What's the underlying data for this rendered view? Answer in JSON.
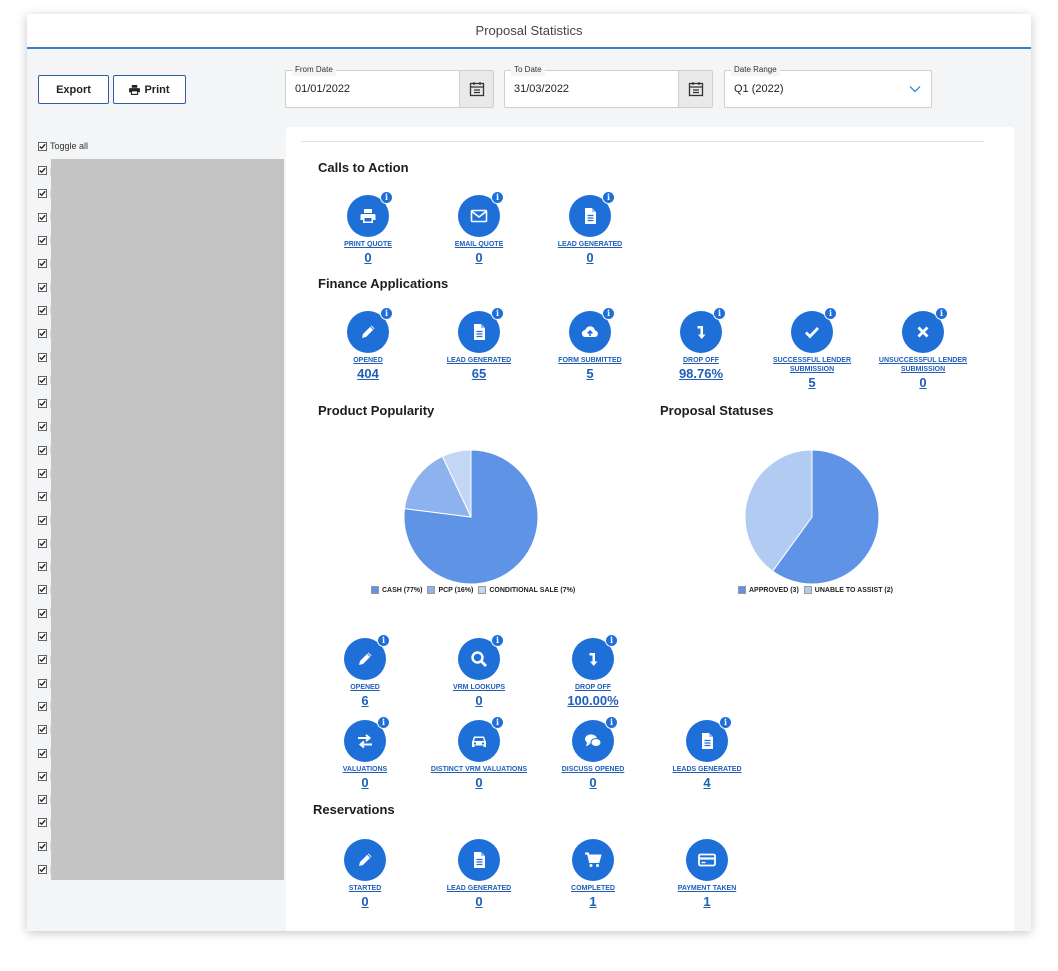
{
  "window": {
    "title": "Proposal Statistics"
  },
  "toolbar": {
    "export_label": "Export",
    "print_label": "Print"
  },
  "filters": {
    "from_date": {
      "label": "From Date",
      "value": "01/01/2022"
    },
    "to_date": {
      "label": "To Date",
      "value": "31/03/2022"
    },
    "date_range": {
      "label": "Date Range",
      "value": "Q1 (2022)"
    }
  },
  "sidebar": {
    "toggle_all": "Toggle all",
    "item_count": 31
  },
  "sections": {
    "calls_to_action": {
      "title": "Calls to Action",
      "stats": [
        {
          "label": "PRINT QUOTE",
          "value": "0",
          "icon": "print-icon"
        },
        {
          "label": "EMAIL QUOTE",
          "value": "0",
          "icon": "envelope-icon"
        },
        {
          "label": "LEAD GENERATED",
          "value": "0",
          "icon": "document-icon"
        }
      ]
    },
    "finance_applications": {
      "title": "Finance Applications",
      "stats": [
        {
          "label": "OPENED",
          "value": "404",
          "icon": "pencil-icon"
        },
        {
          "label": "LEAD GENERATED",
          "value": "65",
          "icon": "document-icon"
        },
        {
          "label": "FORM SUBMITTED",
          "value": "5",
          "icon": "cloud-upload-icon"
        },
        {
          "label": "DROP OFF",
          "value": "98.76%",
          "icon": "drop-arrow-icon"
        },
        {
          "label": "SUCCESSFUL LENDER SUBMISSION",
          "value": "5",
          "icon": "check-icon"
        },
        {
          "label": "UNSUCCESSFUL LENDER SUBMISSION",
          "value": "0",
          "icon": "cross-icon"
        }
      ]
    },
    "product_popularity": {
      "title": "Product Popularity"
    },
    "proposal_statuses": {
      "title": "Proposal Statuses"
    },
    "vehicle": {
      "stats": [
        {
          "label": "OPENED",
          "value": "6",
          "icon": "pencil-icon"
        },
        {
          "label": "VRM LOOKUPS",
          "value": "0",
          "icon": "magnifier-icon"
        },
        {
          "label": "DROP OFF",
          "value": "100.00%",
          "icon": "drop-arrow-icon"
        },
        {
          "label": "VALUATIONS",
          "value": "0",
          "icon": "exchange-icon"
        },
        {
          "label": "DISTINCT VRM VALUATIONS",
          "value": "0",
          "icon": "car-icon"
        },
        {
          "label": "DISCUSS OPENED",
          "value": "0",
          "icon": "chat-icon"
        },
        {
          "label": "LEADS GENERATED",
          "value": "4",
          "icon": "document-icon"
        }
      ]
    },
    "reservations": {
      "title": "Reservations",
      "stats": [
        {
          "label": "STARTED",
          "value": "0",
          "icon": "pencil-icon"
        },
        {
          "label": "LEAD GENERATED",
          "value": "0",
          "icon": "document-icon"
        },
        {
          "label": "COMPLETED",
          "value": "1",
          "icon": "cart-icon"
        },
        {
          "label": "PAYMENT TAKEN",
          "value": "1",
          "icon": "card-icon"
        }
      ]
    }
  },
  "chart_data": [
    {
      "type": "pie",
      "title": "Product Popularity",
      "categories": [
        "CASH (77%)",
        "PCP (16%)",
        "CONDITIONAL SALE (7%)"
      ],
      "values": [
        77,
        16,
        7
      ],
      "colors": [
        "#5f93e6",
        "#8eb2ee",
        "#c3d6f5"
      ],
      "legend": "bottom"
    },
    {
      "type": "pie",
      "title": "Proposal Statuses",
      "categories": [
        "APPROVED (3)",
        "UNABLE TO ASSIST (2)"
      ],
      "values": [
        3,
        2
      ],
      "colors": [
        "#5f93e6",
        "#b1cbf2"
      ],
      "legend": "bottom"
    }
  ]
}
